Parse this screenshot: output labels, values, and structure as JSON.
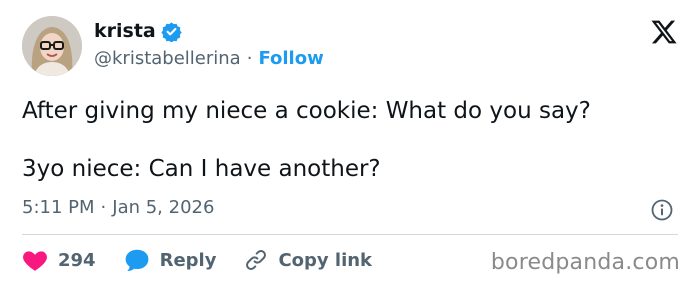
{
  "author": {
    "display_name": "krista",
    "handle": "@kristabellerina",
    "separator": "·",
    "follow_label": "Follow"
  },
  "tweet": {
    "line1": "After giving my niece a cookie: What do you say?",
    "line2": "3yo niece: Can I have another?"
  },
  "meta": {
    "time": "5:11 PM",
    "separator": "·",
    "date": "Jan 5, 2026"
  },
  "actions": {
    "like_count": "294",
    "reply_label": "Reply",
    "copy_link_label": "Copy link"
  },
  "watermark": "boredpanda.com",
  "icons": {
    "logo": "x-logo-icon",
    "verified": "verified-badge-icon",
    "info": "info-icon",
    "like": "heart-icon",
    "reply": "reply-bubble-icon",
    "copy": "link-icon"
  },
  "colors": {
    "accent": "#1d9bf0",
    "like": "#f91880",
    "text": "#0f1419",
    "muted": "#536471"
  }
}
